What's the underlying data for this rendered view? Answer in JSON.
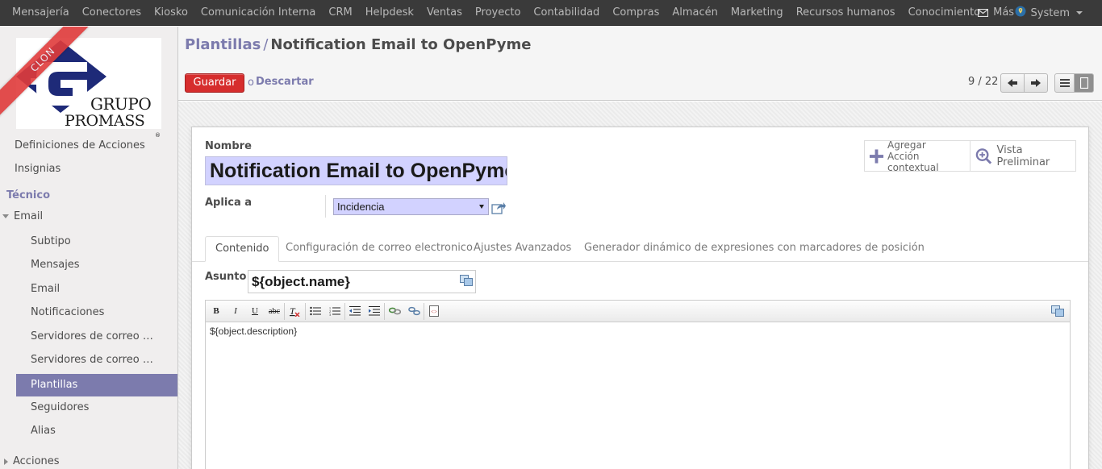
{
  "topbar": {
    "menu": [
      "Mensajería",
      "Conectores",
      "Kiosko",
      "Comunicación Interna",
      "CRM",
      "Helpdesk",
      "Ventas",
      "Proyecto",
      "Contabilidad",
      "Compras",
      "Almacén",
      "Marketing",
      "Recursos humanos",
      "Conocimiento",
      "Más"
    ],
    "user": "System",
    "icons": [
      "envelope-icon",
      "map-pin-icon"
    ]
  },
  "sidebar": {
    "ribbon": "CLON",
    "logo_line1": "GRUPO",
    "logo_line2": "PROMASS",
    "logo_reg": "®",
    "items": [
      {
        "label": "Definiciones de Acciones"
      },
      {
        "label": "Insignias"
      }
    ],
    "section": "Técnico",
    "group": "Email",
    "subitems": [
      "Subtipo",
      "Mensajes",
      "Email",
      "Notificaciones",
      "Servidores de correo entrante",
      "Servidores de correo saliente",
      "Plantillas",
      "Seguidores",
      "Alias"
    ],
    "active": "Plantillas",
    "bottom": "Acciones"
  },
  "control_panel": {
    "breadcrumb_parent": "Plantillas",
    "breadcrumb_sep": "/",
    "breadcrumb_current": "Notification Email to OpenPyme",
    "save_label": "Guardar",
    "or_text": "o",
    "discard_label": "Descartar",
    "pager": "9 / 22"
  },
  "form": {
    "name_label": "Nombre",
    "name_value": "Notification Email to OpenPyme",
    "applies_label": "Aplica a",
    "applies_value": "Incidencia",
    "button_add_line1": "Agregar",
    "button_add_line2": "Acción contextual",
    "button_preview": "Vista Preliminar",
    "tabs": [
      "Contenido",
      "Configuración de correo electronico",
      "Ajustes Avanzados",
      "Generador dinámico de expresiones con marcadores de posición"
    ],
    "active_tab": "Contenido",
    "subject_label": "Asunto",
    "subject_value": "${object.name}",
    "body_text": "${object.description}"
  },
  "colors": {
    "topbar": "#3a3a3a",
    "accent": "#7c7bad",
    "save_button": "#d62d2d",
    "input_required": "#d2d2ff",
    "ribbon": "#e03b3b",
    "logo_blue": "#1e2a78"
  }
}
